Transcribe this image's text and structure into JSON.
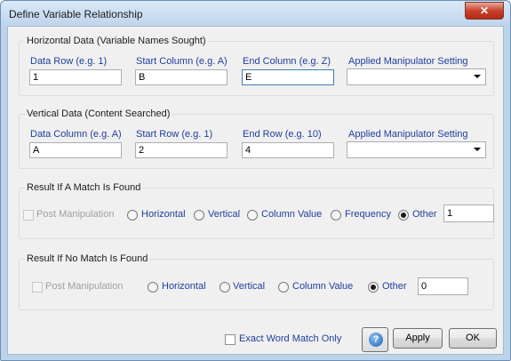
{
  "window": {
    "title": "Define Variable Relationship",
    "close_glyph": "✕"
  },
  "horizontal": {
    "legend": "Horizontal Data (Variable Names Sought)",
    "data_row": {
      "label": "Data Row (e.g. 1)",
      "value": "1"
    },
    "start_column": {
      "label": "Start Column (e.g. A)",
      "value": "B"
    },
    "end_column": {
      "label": "End Column (e.g. Z)",
      "value": "E"
    },
    "manipulator": {
      "label": "Applied Manipulator Setting",
      "value": ""
    }
  },
  "vertical": {
    "legend": "Vertical Data (Content Searched)",
    "data_column": {
      "label": "Data Column (e.g. A)",
      "value": "A"
    },
    "start_row": {
      "label": "Start Row (e.g. 1)",
      "value": "2"
    },
    "end_row": {
      "label": "End Row (e.g. 10)",
      "value": "4"
    },
    "manipulator": {
      "label": "Applied Manipulator Setting",
      "value": ""
    }
  },
  "match_found": {
    "legend": "Result If A Match Is Found",
    "post_manipulation": "Post Manipulation",
    "options": [
      "Horizontal",
      "Vertical",
      "Column Value",
      "Frequency",
      "Other"
    ],
    "selected": "Other",
    "other_value": "1"
  },
  "no_match": {
    "legend": "Result If No Match Is Found",
    "post_manipulation": "Post Manipulation",
    "options": [
      "Horizontal",
      "Vertical",
      "Column Value",
      "Other"
    ],
    "selected": "Other",
    "other_value": "0"
  },
  "footer": {
    "exact_match_label": "Exact Word Match Only",
    "exact_match_checked": false,
    "help_glyph": "?",
    "apply_label": "Apply",
    "ok_label": "OK"
  }
}
